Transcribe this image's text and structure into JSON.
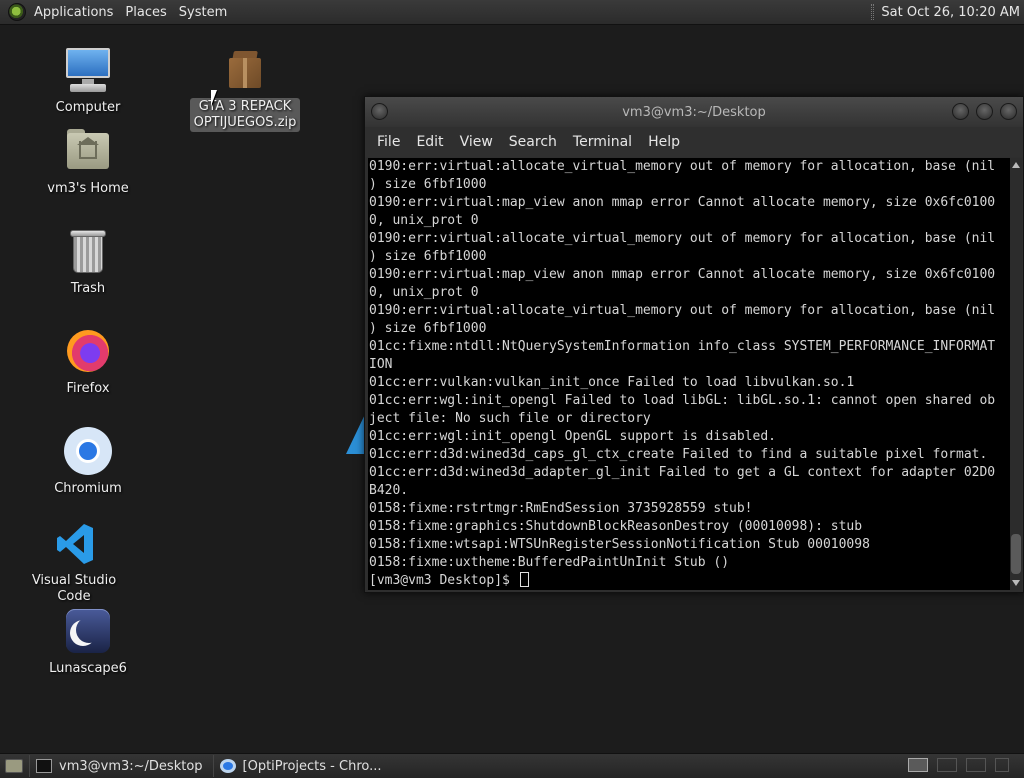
{
  "top_panel": {
    "menu": [
      "Applications",
      "Places",
      "System"
    ],
    "clock": "Sat Oct 26, 10:20 AM"
  },
  "desktop": {
    "icons": [
      {
        "label": "Computer",
        "icon": "computer-icon"
      },
      {
        "label": "vm3's Home",
        "icon": "home-folder-icon"
      },
      {
        "label": "Trash",
        "icon": "trash-icon"
      },
      {
        "label": "Firefox",
        "icon": "firefox-icon"
      },
      {
        "label": "Chromium",
        "icon": "chromium-icon"
      },
      {
        "label": "Visual Studio Code",
        "icon": "vscode-icon"
      },
      {
        "label": "Lunascape6",
        "icon": "lunascape-icon"
      }
    ],
    "zip_file": {
      "label_line1": "GTA 3 REPACK",
      "label_line2": "OPTIJUEGOS.zip",
      "icon": "zip-archive-icon"
    }
  },
  "terminal": {
    "title": "vm3@vm3:~/Desktop",
    "menu": [
      "File",
      "Edit",
      "View",
      "Search",
      "Terminal",
      "Help"
    ],
    "lines": [
      "0190:err:virtual:allocate_virtual_memory out of memory for allocation, base (nil",
      ") size 6fbf1000",
      "0190:err:virtual:map_view anon mmap error Cannot allocate memory, size 0x6fc0100",
      "0, unix_prot 0",
      "0190:err:virtual:allocate_virtual_memory out of memory for allocation, base (nil",
      ") size 6fbf1000",
      "0190:err:virtual:map_view anon mmap error Cannot allocate memory, size 0x6fc0100",
      "0, unix_prot 0",
      "0190:err:virtual:allocate_virtual_memory out of memory for allocation, base (nil",
      ") size 6fbf1000",
      "01cc:fixme:ntdll:NtQuerySystemInformation info_class SYSTEM_PERFORMANCE_INFORMAT",
      "ION",
      "01cc:err:vulkan:vulkan_init_once Failed to load libvulkan.so.1",
      "01cc:err:wgl:init_opengl Failed to load libGL: libGL.so.1: cannot open shared ob",
      "ject file: No such file or directory",
      "01cc:err:wgl:init_opengl OpenGL support is disabled.",
      "01cc:err:d3d:wined3d_caps_gl_ctx_create Failed to find a suitable pixel format.",
      "01cc:err:d3d:wined3d_adapter_gl_init Failed to get a GL context for adapter 02D0",
      "B420.",
      "0158:fixme:rstrtmgr:RmEndSession 3735928559 stub!",
      "0158:fixme:graphics:ShutdownBlockReasonDestroy (00010098): stub",
      "0158:fixme:wtsapi:WTSUnRegisterSessionNotification Stub 00010098",
      "0158:fixme:uxtheme:BufferedPaintUnInit Stub ()"
    ],
    "prompt": "[vm3@vm3 Desktop]$ "
  },
  "taskbar": {
    "tasks": [
      {
        "label": "vm3@vm3:~/Desktop",
        "icon": "terminal-icon"
      },
      {
        "label": "[OptiProjects - Chro...",
        "icon": "chromium-icon"
      }
    ]
  }
}
